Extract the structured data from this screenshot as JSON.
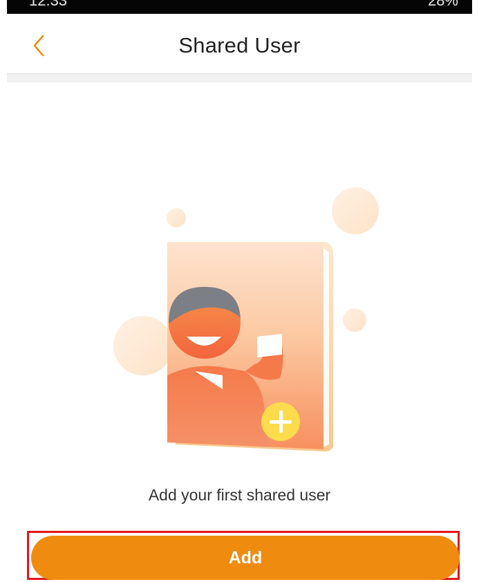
{
  "status_bar": {
    "time": "12:33",
    "right_text": "28%"
  },
  "header": {
    "title": "Shared User",
    "back_icon": "chevron-left-icon",
    "accent_color": "#ef8c10"
  },
  "empty_state": {
    "illustration": "user-book-add-icon",
    "message": "Add your first shared user"
  },
  "actions": {
    "add_label": "Add",
    "add_color": "#ef8c10"
  }
}
